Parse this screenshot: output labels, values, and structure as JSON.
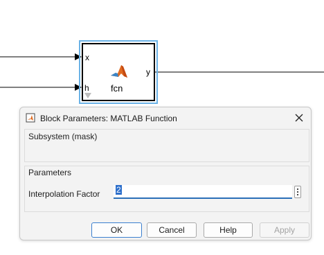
{
  "diagram": {
    "block": {
      "name": "fcn",
      "input_ports": [
        "x",
        "h"
      ],
      "output_ports": [
        "y"
      ]
    }
  },
  "dialog": {
    "title": "Block Parameters: MATLAB Function",
    "mask_group_label": "Subsystem (mask)",
    "params_group_label": "Parameters",
    "param_label": "Interpolation Factor",
    "param_value": "2",
    "buttons": {
      "ok": "OK",
      "cancel": "Cancel",
      "help": "Help",
      "apply": "Apply"
    }
  },
  "colors": {
    "selection": "#6ab2e6",
    "input_underline": "#2a6fb8",
    "ok_border": "#3b7fcf",
    "matlab_logo": "#e06a1f"
  }
}
